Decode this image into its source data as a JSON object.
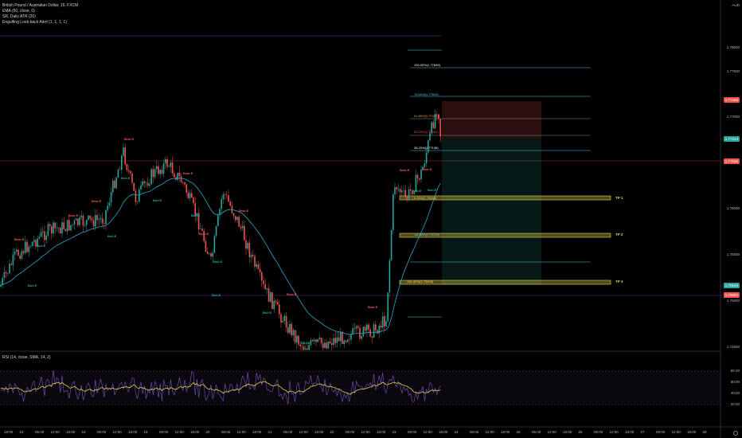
{
  "legend": {
    "symbol": "British Pound / Australian Dollar, 15, FXCM",
    "ema": "EMA (50, close, 0)",
    "atr": "SR, Daily ATR (20)",
    "engulf": "Engulfing Look-back Alert (1, 1, 1, 1)"
  },
  "top_right_label": "AUD",
  "price_axis": [
    "1.78000",
    "1.77500",
    "1.77000",
    "1.76500",
    "1.76000",
    "1.75500",
    "1.75000",
    "1.74500"
  ],
  "tags": {
    "current": "1.77445",
    "bid": "1.77214",
    "last": "1.77045",
    "stop": "1.75645",
    "sl": "1.75604"
  },
  "fib": {
    "f100": "100.00%(1.77849)",
    "f786": "78.60%(1.77603)",
    "f618": "61.80%(1.77403)",
    "f50": "50.00%(1.77262)",
    "f382": "38.20%(1.77138)",
    "f0": "0.00%(1.76649)",
    "f_neg1": "-61.80%(1.76126)",
    "f_neg2": "-161.80%(1.75605)"
  },
  "targets": {
    "tp1": "TP 1",
    "tp2": "TP 2",
    "tp3": "TP 3"
  },
  "signals": {
    "buy": "Bull.E",
    "sell": "Bear.E"
  },
  "rsi": {
    "label": "RSI (14, close, SMA, 14, 2)",
    "axis": [
      "80.00",
      "60.00",
      "40.00",
      "20.00"
    ]
  },
  "x_axis": [
    "18:00",
    "15",
    "06:00",
    "12:00",
    "18:00",
    "18",
    "06:00",
    "12:00",
    "18:00",
    "19",
    "06:00",
    "12:00",
    "18:00",
    "20",
    "06:00",
    "12:00",
    "18:00",
    "21",
    "06:00",
    "12:00",
    "18:00",
    "22",
    "06:00",
    "12:00",
    "18:00",
    "23",
    "06:00",
    "12:00",
    "18:00",
    "24",
    "06:00",
    "12:00",
    "18:00",
    "25",
    "06:00",
    "12:00",
    "18:00",
    "26",
    "06:00",
    "12:00",
    "18:00",
    "27",
    "06:00",
    "12:00",
    "18:00",
    "28"
  ]
}
